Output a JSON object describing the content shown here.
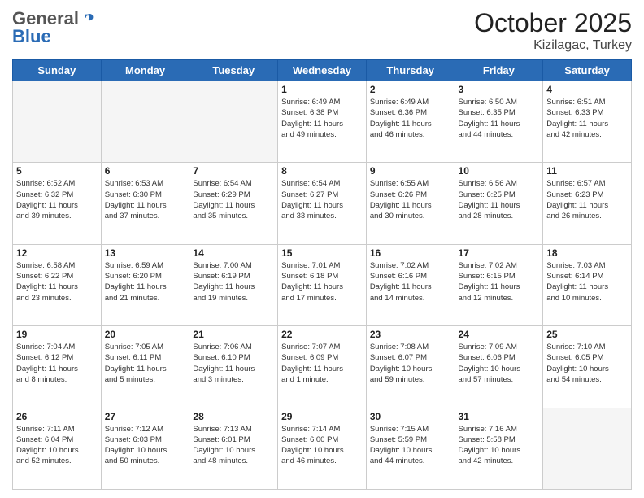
{
  "header": {
    "logo_general": "General",
    "logo_blue": "Blue",
    "month_title": "October 2025",
    "location": "Kizilagac, Turkey"
  },
  "weekdays": [
    "Sunday",
    "Monday",
    "Tuesday",
    "Wednesday",
    "Thursday",
    "Friday",
    "Saturday"
  ],
  "weeks": [
    [
      {
        "day": "",
        "info": ""
      },
      {
        "day": "",
        "info": ""
      },
      {
        "day": "",
        "info": ""
      },
      {
        "day": "1",
        "info": "Sunrise: 6:49 AM\nSunset: 6:38 PM\nDaylight: 11 hours\nand 49 minutes."
      },
      {
        "day": "2",
        "info": "Sunrise: 6:49 AM\nSunset: 6:36 PM\nDaylight: 11 hours\nand 46 minutes."
      },
      {
        "day": "3",
        "info": "Sunrise: 6:50 AM\nSunset: 6:35 PM\nDaylight: 11 hours\nand 44 minutes."
      },
      {
        "day": "4",
        "info": "Sunrise: 6:51 AM\nSunset: 6:33 PM\nDaylight: 11 hours\nand 42 minutes."
      }
    ],
    [
      {
        "day": "5",
        "info": "Sunrise: 6:52 AM\nSunset: 6:32 PM\nDaylight: 11 hours\nand 39 minutes."
      },
      {
        "day": "6",
        "info": "Sunrise: 6:53 AM\nSunset: 6:30 PM\nDaylight: 11 hours\nand 37 minutes."
      },
      {
        "day": "7",
        "info": "Sunrise: 6:54 AM\nSunset: 6:29 PM\nDaylight: 11 hours\nand 35 minutes."
      },
      {
        "day": "8",
        "info": "Sunrise: 6:54 AM\nSunset: 6:27 PM\nDaylight: 11 hours\nand 33 minutes."
      },
      {
        "day": "9",
        "info": "Sunrise: 6:55 AM\nSunset: 6:26 PM\nDaylight: 11 hours\nand 30 minutes."
      },
      {
        "day": "10",
        "info": "Sunrise: 6:56 AM\nSunset: 6:25 PM\nDaylight: 11 hours\nand 28 minutes."
      },
      {
        "day": "11",
        "info": "Sunrise: 6:57 AM\nSunset: 6:23 PM\nDaylight: 11 hours\nand 26 minutes."
      }
    ],
    [
      {
        "day": "12",
        "info": "Sunrise: 6:58 AM\nSunset: 6:22 PM\nDaylight: 11 hours\nand 23 minutes."
      },
      {
        "day": "13",
        "info": "Sunrise: 6:59 AM\nSunset: 6:20 PM\nDaylight: 11 hours\nand 21 minutes."
      },
      {
        "day": "14",
        "info": "Sunrise: 7:00 AM\nSunset: 6:19 PM\nDaylight: 11 hours\nand 19 minutes."
      },
      {
        "day": "15",
        "info": "Sunrise: 7:01 AM\nSunset: 6:18 PM\nDaylight: 11 hours\nand 17 minutes."
      },
      {
        "day": "16",
        "info": "Sunrise: 7:02 AM\nSunset: 6:16 PM\nDaylight: 11 hours\nand 14 minutes."
      },
      {
        "day": "17",
        "info": "Sunrise: 7:02 AM\nSunset: 6:15 PM\nDaylight: 11 hours\nand 12 minutes."
      },
      {
        "day": "18",
        "info": "Sunrise: 7:03 AM\nSunset: 6:14 PM\nDaylight: 11 hours\nand 10 minutes."
      }
    ],
    [
      {
        "day": "19",
        "info": "Sunrise: 7:04 AM\nSunset: 6:12 PM\nDaylight: 11 hours\nand 8 minutes."
      },
      {
        "day": "20",
        "info": "Sunrise: 7:05 AM\nSunset: 6:11 PM\nDaylight: 11 hours\nand 5 minutes."
      },
      {
        "day": "21",
        "info": "Sunrise: 7:06 AM\nSunset: 6:10 PM\nDaylight: 11 hours\nand 3 minutes."
      },
      {
        "day": "22",
        "info": "Sunrise: 7:07 AM\nSunset: 6:09 PM\nDaylight: 11 hours\nand 1 minute."
      },
      {
        "day": "23",
        "info": "Sunrise: 7:08 AM\nSunset: 6:07 PM\nDaylight: 10 hours\nand 59 minutes."
      },
      {
        "day": "24",
        "info": "Sunrise: 7:09 AM\nSunset: 6:06 PM\nDaylight: 10 hours\nand 57 minutes."
      },
      {
        "day": "25",
        "info": "Sunrise: 7:10 AM\nSunset: 6:05 PM\nDaylight: 10 hours\nand 54 minutes."
      }
    ],
    [
      {
        "day": "26",
        "info": "Sunrise: 7:11 AM\nSunset: 6:04 PM\nDaylight: 10 hours\nand 52 minutes."
      },
      {
        "day": "27",
        "info": "Sunrise: 7:12 AM\nSunset: 6:03 PM\nDaylight: 10 hours\nand 50 minutes."
      },
      {
        "day": "28",
        "info": "Sunrise: 7:13 AM\nSunset: 6:01 PM\nDaylight: 10 hours\nand 48 minutes."
      },
      {
        "day": "29",
        "info": "Sunrise: 7:14 AM\nSunset: 6:00 PM\nDaylight: 10 hours\nand 46 minutes."
      },
      {
        "day": "30",
        "info": "Sunrise: 7:15 AM\nSunset: 5:59 PM\nDaylight: 10 hours\nand 44 minutes."
      },
      {
        "day": "31",
        "info": "Sunrise: 7:16 AM\nSunset: 5:58 PM\nDaylight: 10 hours\nand 42 minutes."
      },
      {
        "day": "",
        "info": ""
      }
    ]
  ]
}
